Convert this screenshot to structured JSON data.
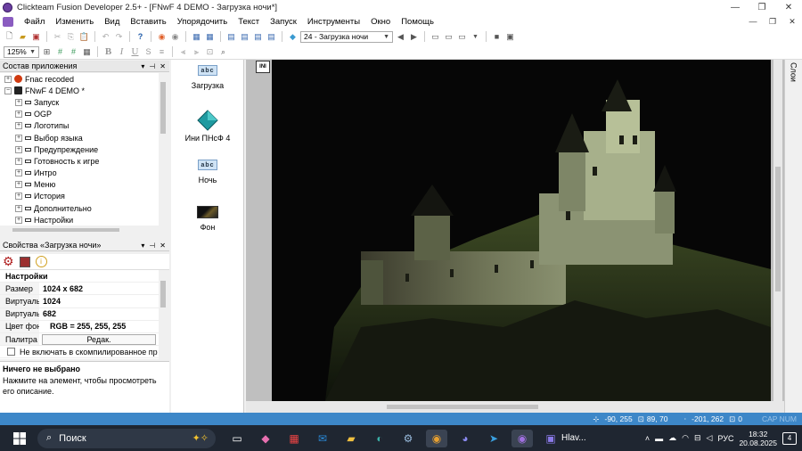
{
  "window": {
    "title": "Clickteam Fusion Developer 2.5+ - [FNwF 4 DEMO - Загрузка ночи*]"
  },
  "menu": [
    "Файл",
    "Изменить",
    "Вид",
    "Вставить",
    "Упорядочить",
    "Текст",
    "Запуск",
    "Инструменты",
    "Окно",
    "Помощь"
  ],
  "toolbar": {
    "frame_select": "24 - Загрузка ночи",
    "zoom": "125%"
  },
  "workspace": {
    "title": "Состав приложения",
    "items": [
      {
        "label": "Fnac recoded",
        "level": 0,
        "exp": "+"
      },
      {
        "label": "FNwF 4 DEMO *",
        "level": 0,
        "exp": "−"
      },
      {
        "label": "Запуск",
        "level": 1,
        "exp": "+"
      },
      {
        "label": "OGP",
        "level": 1,
        "exp": "+"
      },
      {
        "label": "Логотипы",
        "level": 1,
        "exp": "+"
      },
      {
        "label": "Выбор языка",
        "level": 1,
        "exp": "+"
      },
      {
        "label": "Предупреждение",
        "level": 1,
        "exp": "+"
      },
      {
        "label": "Готовность к игре",
        "level": 1,
        "exp": "+"
      },
      {
        "label": "Интро",
        "level": 1,
        "exp": "+"
      },
      {
        "label": "Меню",
        "level": 1,
        "exp": "+"
      },
      {
        "label": "История",
        "level": 1,
        "exp": "+"
      },
      {
        "label": "Дополнительно",
        "level": 1,
        "exp": "+"
      },
      {
        "label": "Настройки",
        "level": 1,
        "exp": "+"
      }
    ]
  },
  "properties": {
    "title": "Свойства «Загрузка ночи»",
    "section": "Настройки",
    "rows": [
      {
        "key": "Размер",
        "value": "1024 x 682"
      },
      {
        "key": "Виртуальн",
        "value": "1024"
      },
      {
        "key": "Виртуальн",
        "value": "682"
      },
      {
        "key": "Цвет фона",
        "value": "RGB = 255, 255, 255"
      },
      {
        "key": "Палитра",
        "value": "Редак."
      }
    ],
    "checkbox_label": "Не включать в скомпилированное пр",
    "desc_title": "Ничего не выбрано",
    "desc_text": "Нажмите на элемент, чтобы просмотреть его описание."
  },
  "objects": [
    {
      "label": "Загрузка",
      "kind": "text"
    },
    {
      "label": "Ини ПНсФ 4",
      "kind": "diamond"
    },
    {
      "label": "Ночь",
      "kind": "text"
    },
    {
      "label": "Фон",
      "kind": "image"
    }
  ],
  "layers_label": "Слои",
  "status": {
    "coords1": "-90, 255",
    "coords2": "89, 70",
    "coords3": "-201, 262",
    "count": "0",
    "caps": "CAP NUM"
  },
  "taskbar": {
    "search": "Поиск",
    "app_label": "Hlav...",
    "lang": "РУС",
    "time": "18:32",
    "date": "20.08.2025",
    "notif": "4"
  }
}
